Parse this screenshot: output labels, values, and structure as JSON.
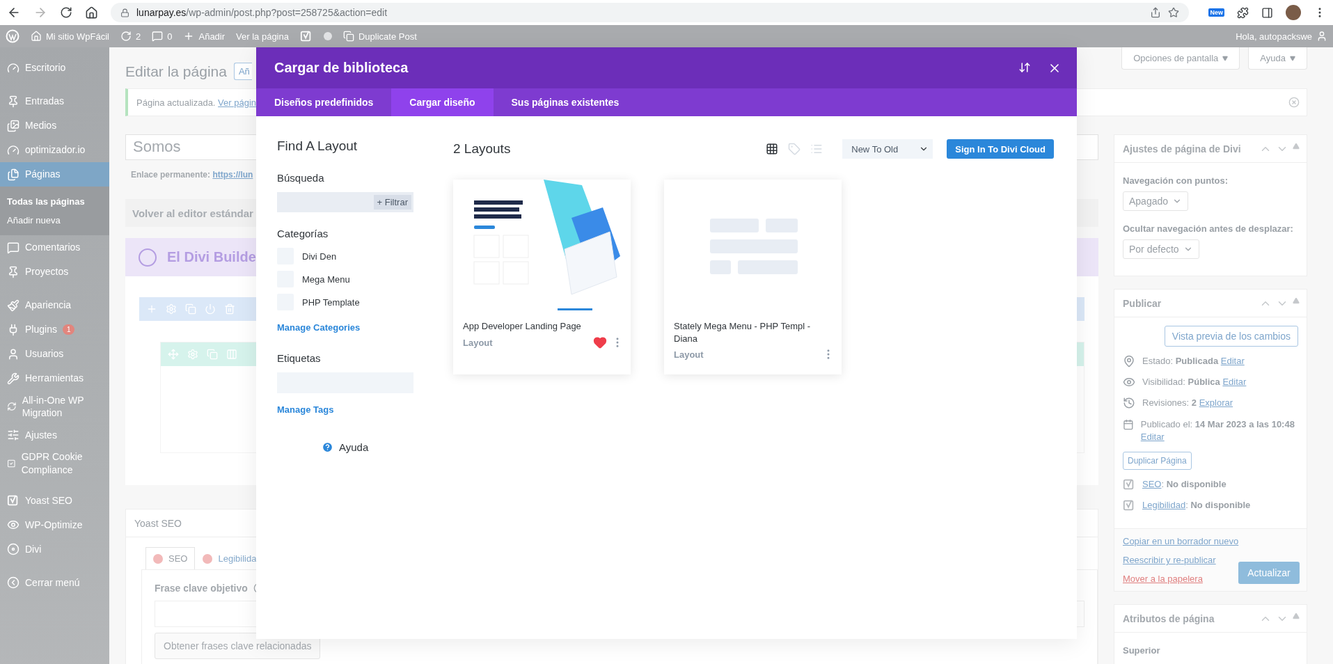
{
  "browser": {
    "url_domain": "lunarpay.es",
    "url_path": "/wp-admin/post.php?post=258725&action=edit",
    "extension_badge": "New"
  },
  "admin_bar": {
    "items": [
      {
        "label": "Mi sitio WpFácil"
      },
      {
        "label": "2"
      },
      {
        "label": "0"
      },
      {
        "label": "Añadir"
      },
      {
        "label": "Ver la página"
      },
      {
        "label": "Duplicate Post"
      }
    ],
    "greeting": "Hola, autopackswe"
  },
  "sidebar": {
    "groups": [
      [
        {
          "label": "Escritorio",
          "selected": false
        }
      ],
      [
        {
          "label": "Entradas",
          "selected": false
        },
        {
          "label": "Medios",
          "selected": false
        },
        {
          "label": "optimizador.io",
          "selected": false
        },
        {
          "label": "Páginas",
          "selected": true,
          "children": [
            {
              "label": "Todas las páginas",
              "selected": true
            },
            {
              "label": "Añadir nueva",
              "selected": false
            }
          ]
        },
        {
          "label": "Comentarios",
          "selected": false
        },
        {
          "label": "Proyectos",
          "selected": false
        }
      ],
      [
        {
          "label": "Apariencia",
          "selected": false
        },
        {
          "label": "Plugins",
          "selected": false,
          "badge": "1"
        },
        {
          "label": "Usuarios",
          "selected": false
        },
        {
          "label": "Herramientas",
          "selected": false
        },
        {
          "label": "All-in-One WP Migration",
          "selected": false
        },
        {
          "label": "Ajustes",
          "selected": false
        },
        {
          "label": "GDPR Cookie Compliance",
          "selected": false
        }
      ],
      [
        {
          "label": "Yoast SEO",
          "selected": false
        },
        {
          "label": "WP-Optimize",
          "selected": false
        },
        {
          "label": "Divi",
          "selected": false
        }
      ]
    ],
    "collapse": "Cerrar menú"
  },
  "screen_options": [
    {
      "label": "Opciones de pantalla"
    },
    {
      "label": "Ayuda"
    }
  ],
  "page": {
    "title": "Editar la página",
    "add_button": "Añ",
    "notice": {
      "text": "Página actualizada.",
      "link": "Ver págin"
    },
    "post_title": "Somos",
    "permalink": {
      "label": "Enlace permanente:",
      "link": "https://lun"
    },
    "classic_button": "Volver al editor estándar",
    "divi_builder": "El Divi Builde",
    "yoast": {
      "title": "Yoast SEO",
      "tabs": [
        {
          "label": "SEO",
          "selected": true
        },
        {
          "label": "Legibilida",
          "selected": false
        }
      ],
      "keyphrase_label": "Frase clave objetivo",
      "related_button": "Obtener frases clave relacionadas"
    }
  },
  "divi_settings": {
    "title": "Ajustes de página de Divi",
    "fields": [
      {
        "label": "Navegación con puntos:",
        "value": "Apagado"
      },
      {
        "label": "Ocultar navegación antes de desplazar:",
        "value": "Por defecto"
      }
    ]
  },
  "publish": {
    "title": "Publicar",
    "preview_button": "Vista previa de los cambios",
    "rows": [
      {
        "text": "Estado: **Publicada**",
        "link": "Editar"
      },
      {
        "text": "Visibilidad: **Pública**",
        "link": "Editar"
      },
      {
        "text": "Revisiones: **2**",
        "link": "Explorar"
      },
      {
        "text": "Publicado el: **14 Mar 2023 a las 10:48**",
        "link": "Editar"
      }
    ],
    "duplicate_button": "Duplicar Página",
    "seo_rows": [
      {
        "link": "SEO",
        "text": ": **No disponible**"
      },
      {
        "link": "Legibilidad",
        "text": ": **No disponible**"
      }
    ],
    "actions": [
      {
        "label": "Copiar en un borrador nuevo",
        "kind": "link"
      },
      {
        "label": "Reescribir y re-publicar",
        "kind": "link"
      },
      {
        "label": "Mover a la papelera",
        "kind": "danger"
      }
    ],
    "update_button": "Actualizar"
  },
  "page_attributes": {
    "title": "Atributos de página",
    "label": "Superior"
  },
  "modal": {
    "title": "Cargar de biblioteca",
    "tabs": [
      {
        "label": "Diseños predefinidos",
        "selected": false
      },
      {
        "label": "Cargar diseño",
        "selected": true
      },
      {
        "label": "Sus páginas existentes",
        "selected": false
      }
    ],
    "sidebar": {
      "heading": "Find A Layout",
      "search_label": "Búsqueda",
      "filter_button": "+ Filtrar",
      "categories_label": "Categorías",
      "categories": [
        {
          "label": "Divi Den",
          "checked": false
        },
        {
          "label": "Mega Menu",
          "checked": false
        },
        {
          "label": "PHP Template",
          "checked": false
        }
      ],
      "manage_categories": "Manage Categories",
      "tags_label": "Etiquetas",
      "manage_tags": "Manage Tags",
      "help": "Ayuda"
    },
    "count": "2 Layouts",
    "views": [
      {
        "kind": "grid",
        "selected": true
      },
      {
        "kind": "tag",
        "selected": false
      },
      {
        "kind": "list",
        "selected": false
      }
    ],
    "sort": "New To Old",
    "cloud_button": "Sign In To Divi Cloud",
    "layouts": [
      {
        "kind": "picture",
        "title": "App Developer Landing Page",
        "type": "Layout",
        "favorite": true
      },
      {
        "kind": "placeholder",
        "title": "Stately Mega Menu - PHP Templ - Diana",
        "type": "Layout",
        "favorite": false
      }
    ]
  }
}
